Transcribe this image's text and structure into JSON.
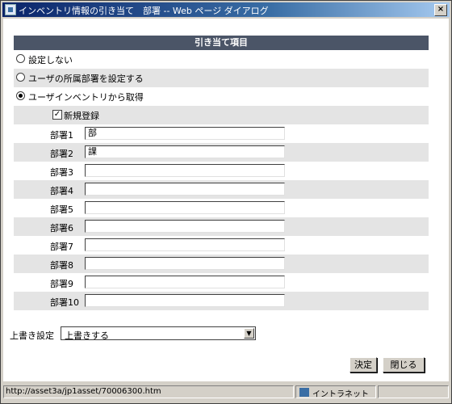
{
  "window": {
    "title": "インベントリ情報の引き当て　部署 -- Web ページ ダイアログ",
    "close_glyph": "×"
  },
  "panel": {
    "header": "引き当て項目",
    "options": [
      {
        "label": "設定しない",
        "selected": false
      },
      {
        "label": "ユーザの所属部署を設定する",
        "selected": false
      },
      {
        "label": "ユーザインベントリから取得",
        "selected": true
      }
    ],
    "new_registration": {
      "label": "新規登録",
      "checked": true,
      "check_glyph": "✓"
    },
    "departments": [
      {
        "label": "部署1",
        "value": "部"
      },
      {
        "label": "部署2",
        "value": "課"
      },
      {
        "label": "部署3",
        "value": ""
      },
      {
        "label": "部署4",
        "value": ""
      },
      {
        "label": "部署5",
        "value": ""
      },
      {
        "label": "部署6",
        "value": ""
      },
      {
        "label": "部署7",
        "value": ""
      },
      {
        "label": "部署8",
        "value": ""
      },
      {
        "label": "部署9",
        "value": ""
      },
      {
        "label": "部署10",
        "value": ""
      }
    ]
  },
  "overwrite": {
    "label": "上書き設定",
    "value": "上書きする",
    "arrow_glyph": "▼"
  },
  "buttons": {
    "ok": "決定",
    "close": "閉じる"
  },
  "status": {
    "url": "http://asset3a/jp1asset/70006300.htm",
    "zone": "イントラネット"
  }
}
